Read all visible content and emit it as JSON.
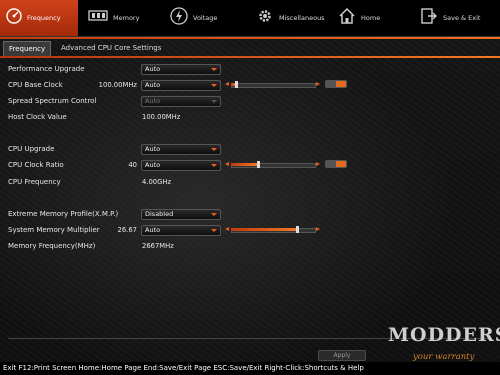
{
  "nav": {
    "items": [
      {
        "label": "Frequency",
        "icon": "frequency-icon",
        "active": true
      },
      {
        "label": "Memory",
        "icon": "memory-icon",
        "active": false
      },
      {
        "label": "Voltage",
        "icon": "voltage-icon",
        "active": false
      },
      {
        "label": "Miscellaneous",
        "icon": "gear-icon",
        "active": false
      },
      {
        "label": "Home",
        "icon": "home-icon",
        "active": false
      },
      {
        "label": "Save & Exit",
        "icon": "exit-icon",
        "active": false
      }
    ]
  },
  "tabs": [
    {
      "label": "Frequency",
      "active": true
    },
    {
      "label": "Advanced CPU Core Settings",
      "active": false
    }
  ],
  "settings": {
    "performance_upgrade": {
      "label": "Performance Upgrade",
      "value": "Auto"
    },
    "cpu_base_clock": {
      "label": "CPU Base Clock",
      "current": "100.00MHz",
      "value": "Auto"
    },
    "spread_spectrum": {
      "label": "Spread Spectrum Control",
      "value": "Auto",
      "disabled": true
    },
    "host_clock_value": {
      "label": "Host Clock Value",
      "value": "100.00MHz"
    },
    "cpu_upgrade": {
      "label": "CPU Upgrade",
      "value": "Auto"
    },
    "cpu_clock_ratio": {
      "label": "CPU Clock Ratio",
      "current": "40",
      "value": "Auto"
    },
    "cpu_frequency": {
      "label": "CPU Frequency",
      "value": "4.00GHz"
    },
    "xmp": {
      "label": "Extreme Memory Profile(X.M.P.)",
      "value": "Disabled"
    },
    "system_memory_multiplier": {
      "label": "System Memory Multiplier",
      "current": "26.67",
      "value": "Auto"
    },
    "memory_frequency": {
      "label": "Memory Frequency(MHz)",
      "value": "2667MHz"
    }
  },
  "apply_label": "Apply",
  "status_text": "Exit F12:Print Screen Home:Home Page End:Save/Exit Page ESC:Save/Exit Right-Click:Shortcuts & Help",
  "watermark": {
    "line1": "MODDERS",
    "line2": "your warranty"
  },
  "colors": {
    "accent": "#e4601a",
    "background": "#1a1a1a"
  }
}
